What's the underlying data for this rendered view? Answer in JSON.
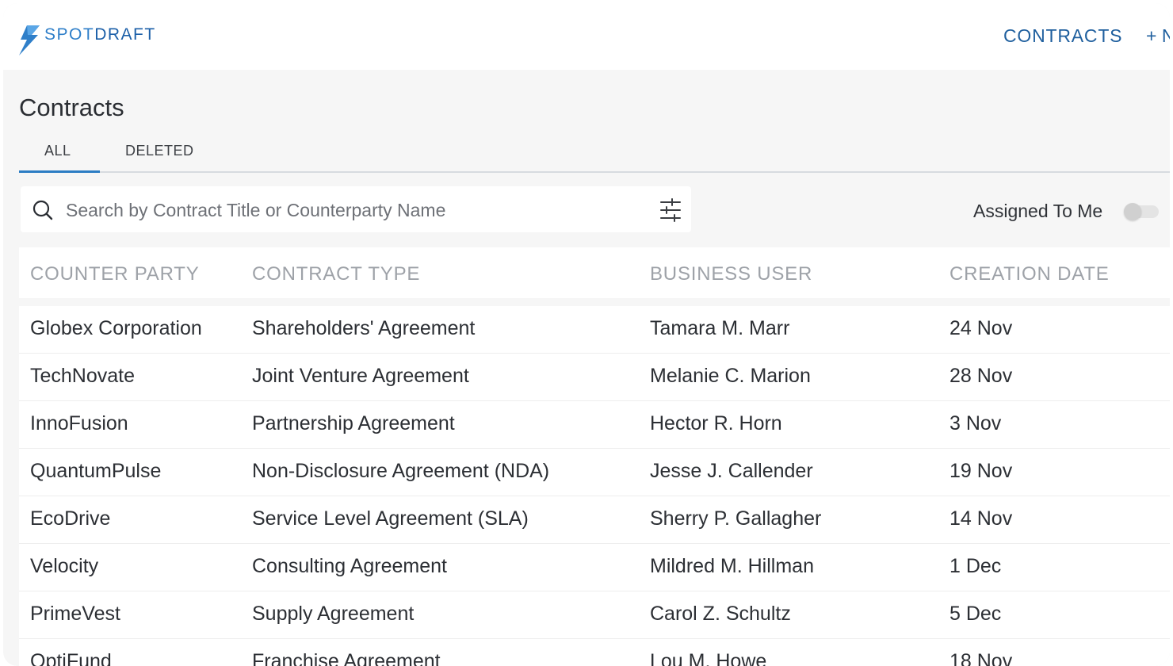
{
  "brand": {
    "name_part1": "SPOT",
    "name_part2": "DRAFT",
    "logo_icon": "lightning-bolt-icon"
  },
  "nav": {
    "contracts_label": "CONTRACTS",
    "new_label": "+ N"
  },
  "page": {
    "title": "Contracts"
  },
  "tabs": [
    {
      "label": "ALL",
      "active": true
    },
    {
      "label": "DELETED",
      "active": false
    }
  ],
  "search": {
    "placeholder": "Search by Contract Title or Counterparty Name",
    "icon": "search-icon",
    "filter_icon": "sliders-icon"
  },
  "assigned_toggle": {
    "label": "Assigned To Me",
    "on": false
  },
  "table": {
    "headers": [
      "COUNTER PARTY",
      "CONTRACT TYPE",
      "BUSINESS USER",
      "CREATION DATE"
    ],
    "rows": [
      [
        "Globex Corporation",
        "Shareholders' Agreement",
        "Tamara M. Marr",
        "24 Nov"
      ],
      [
        "TechNovate",
        "Joint Venture Agreement",
        "Melanie C. Marion",
        "28 Nov"
      ],
      [
        "InnoFusion",
        "Partnership Agreement",
        "Hector R. Horn",
        "3 Nov"
      ],
      [
        "QuantumPulse",
        "Non-Disclosure Agreement (NDA)",
        "Jesse J. Callender",
        "19 Nov"
      ],
      [
        "EcoDrive",
        "Service Level Agreement (SLA)",
        "Sherry P. Gallagher",
        "14 Nov"
      ],
      [
        "Velocity",
        "Consulting Agreement",
        "Mildred M. Hillman",
        "1 Dec"
      ],
      [
        "PrimeVest",
        "Supply Agreement",
        "Carol Z. Schultz",
        "5 Dec"
      ],
      [
        "OptiFund",
        "Franchise Agreement",
        "Lou M. Howe",
        "18 Nov"
      ]
    ]
  },
  "colors": {
    "accent": "#2c7dc4",
    "nav_link": "#1f5f9e",
    "header_text": "#9ea2a8",
    "page_bg": "#f6f6f6"
  }
}
